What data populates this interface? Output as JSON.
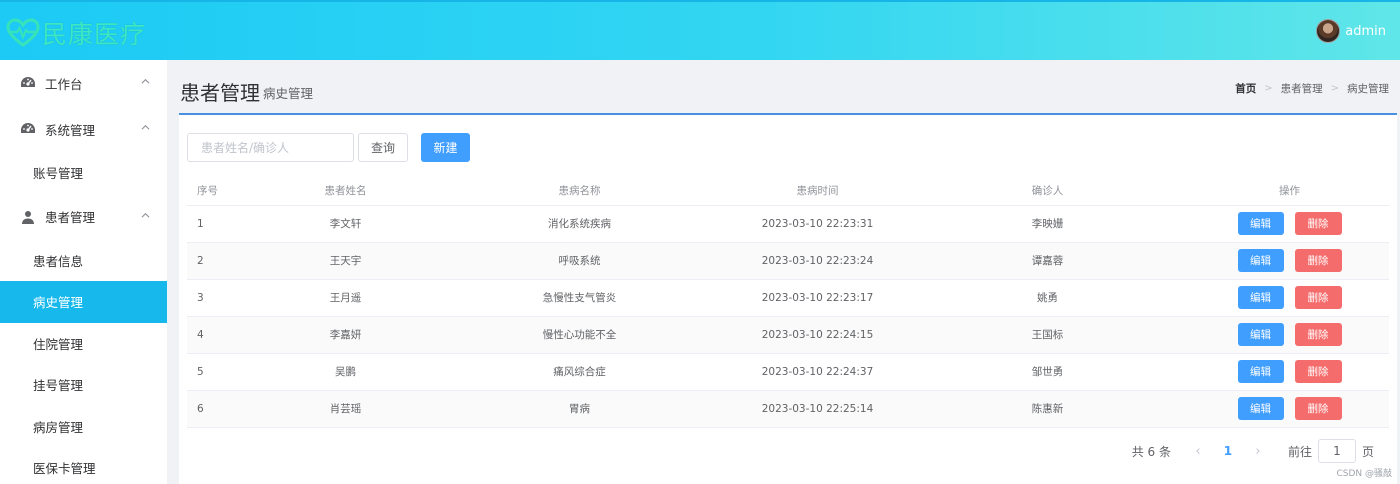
{
  "header": {
    "logo_text": "民康医疗",
    "username": "admin"
  },
  "sidebar": {
    "groups": [
      {
        "label": "工作台",
        "icon": "dashboard-icon",
        "items": []
      },
      {
        "label": "系统管理",
        "icon": "dashboard-icon",
        "items": [
          "账号管理"
        ]
      },
      {
        "label": "患者管理",
        "icon": "user-icon",
        "items": [
          "患者信息",
          "病史管理",
          "住院管理",
          "挂号管理",
          "病房管理",
          "医保卡管理"
        ]
      }
    ],
    "active_item": "病史管理"
  },
  "page": {
    "title": "患者管理",
    "subtitle": "病史管理",
    "breadcrumb": [
      "首页",
      "患者管理",
      "病史管理"
    ]
  },
  "toolbar": {
    "search_placeholder": "患者姓名/确诊人",
    "query_label": "查询",
    "new_label": "新建"
  },
  "table": {
    "columns": [
      "序号",
      "患者姓名",
      "患病名称",
      "患病时间",
      "确诊人",
      "操作"
    ],
    "rows": [
      {
        "idx": "1",
        "name": "李文轩",
        "disease": "消化系统疾病",
        "time": "2023-03-10 22:23:31",
        "doctor": "李映姗"
      },
      {
        "idx": "2",
        "name": "王天宇",
        "disease": "呼吸系统",
        "time": "2023-03-10 22:23:24",
        "doctor": "谭嘉蓉"
      },
      {
        "idx": "3",
        "name": "王月遥",
        "disease": "急慢性支气管炎",
        "time": "2023-03-10 22:23:17",
        "doctor": "姚勇"
      },
      {
        "idx": "4",
        "name": "李嘉妍",
        "disease": "慢性心功能不全",
        "time": "2023-03-10 22:24:15",
        "doctor": "王国标"
      },
      {
        "idx": "5",
        "name": "吴鹏",
        "disease": "痛风综合症",
        "time": "2023-03-10 22:24:37",
        "doctor": "邹世勇"
      },
      {
        "idx": "6",
        "name": "肖芸瑶",
        "disease": "胃病",
        "time": "2023-03-10 22:25:14",
        "doctor": "陈惠新"
      }
    ],
    "edit_label": "编辑",
    "delete_label": "删除"
  },
  "pagination": {
    "total_text": "共 6 条",
    "current_page": "1",
    "goto_label": "前往",
    "goto_value": "1",
    "page_suffix": "页"
  },
  "watermark": "CSDN @骚敲",
  "colors": {
    "primary": "#409eff",
    "danger": "#f56c6c",
    "sidebar_active": "#17b9ec",
    "header_start": "#1ccaf5",
    "header_end": "#5fe6e8"
  }
}
